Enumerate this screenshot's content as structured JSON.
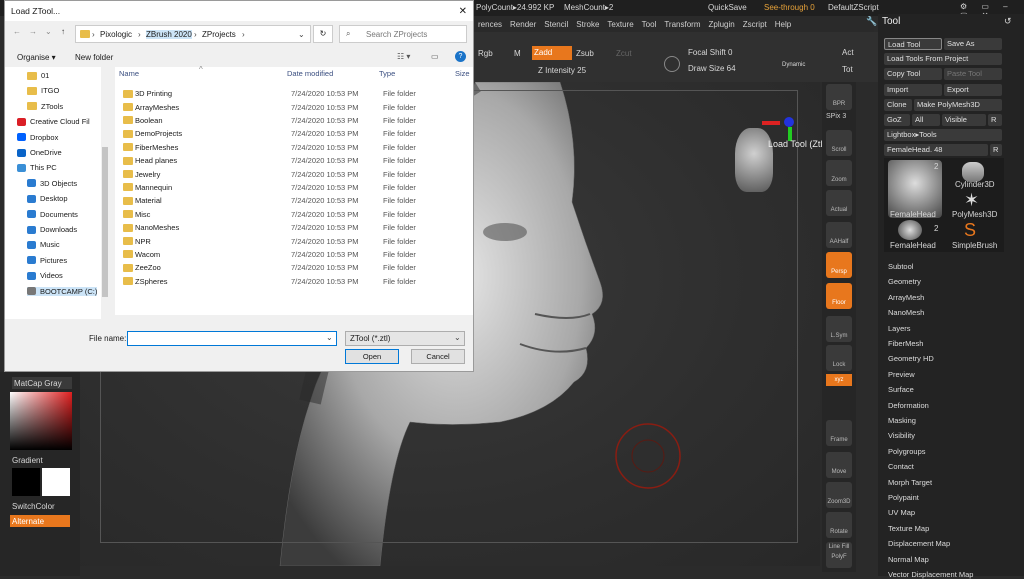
{
  "zbrush": {
    "topbar": {
      "polycount": "PolyCount▸24.992 KP",
      "meshcount": "MeshCount▸2",
      "quicksave": "QuickSave",
      "seethrough": "See-through 0",
      "script": "DefaultZScript"
    },
    "menu": [
      "rences",
      "Render",
      "Stencil",
      "Stroke",
      "Texture",
      "Tool",
      "Transform",
      "Zplugin",
      "Zscript",
      "Help"
    ],
    "shelf": {
      "rgb": "Rgb",
      "m": "M",
      "zadd": "Zadd",
      "zsub": "Zsub",
      "zcut": "Zcut",
      "zintensity": "Z Intensity 25",
      "focal": "Focal Shift 0",
      "drawsize": "Draw Size 64",
      "dynamic": "Dynamic",
      "act": "Act",
      "tot": "Tot"
    },
    "canvas_label": "Load Tool (Ztl File)",
    "vbar": [
      "BPR",
      "SPix 3",
      "Scroll",
      "Zoom",
      "Actual",
      "AAHalf",
      "Persp",
      "Floor",
      "L.Sym",
      "Lock",
      "xyz",
      "Frame",
      "Move",
      "Zoom3D",
      "Rotate",
      "Line Fill PolyF"
    ],
    "tool": {
      "title": "Tool",
      "load_tool": "Load Tool",
      "save_as": "Save As",
      "load_from_project": "Load Tools From Project",
      "copy_tool": "Copy Tool",
      "paste_tool": "Paste Tool",
      "import": "Import",
      "export": "Export",
      "clone": "Clone",
      "make_polymesh": "Make PolyMesh3D",
      "goz": "GoZ",
      "all": "All",
      "visible": "Visible",
      "r": "R",
      "lightbox": "Lightbox▸Tools",
      "current": "FemaleHead. 48",
      "thumbs": [
        "FemaleHead",
        "Cylinder3D",
        "FemaleHead",
        "PolyMesh3D",
        "FemaleHead",
        "SimpleBrush"
      ],
      "thumb_count": "2",
      "subpalettes": [
        "Subtool",
        "Geometry",
        "ArrayMesh",
        "NanoMesh",
        "Layers",
        "FiberMesh",
        "Geometry HD",
        "Preview",
        "Surface",
        "Deformation",
        "Masking",
        "Visibility",
        "Polygroups",
        "Contact",
        "Morph Target",
        "Polypaint",
        "UV Map",
        "Texture Map",
        "Displacement Map",
        "Normal Map",
        "Vector Displacement Map"
      ]
    },
    "left": {
      "matcap": "MatCap Gray",
      "gradient": "Gradient",
      "switchcolor": "SwitchColor",
      "alternate": "Alternate"
    }
  },
  "dialog": {
    "title": "Load ZTool...",
    "breadcrumb": [
      "Pixologic",
      "ZBrush 2020",
      "ZProjects"
    ],
    "search_placeholder": "Search ZProjects",
    "organise": "Organise ▾",
    "new_folder": "New folder",
    "help": "?",
    "nav": [
      "01",
      "ITGO",
      "ZTools",
      "Creative Cloud Fil",
      "Dropbox",
      "OneDrive",
      "This PC",
      "3D Objects",
      "Desktop",
      "Documents",
      "Downloads",
      "Music",
      "Pictures",
      "Videos",
      "BOOTCAMP (C:)"
    ],
    "columns": {
      "name": "Name",
      "date": "Date modified",
      "type": "Type",
      "size": "Size"
    },
    "files": [
      {
        "name": "3D Printing",
        "date": "7/24/2020 10:53 PM",
        "type": "File folder"
      },
      {
        "name": "ArrayMeshes",
        "date": "7/24/2020 10:53 PM",
        "type": "File folder"
      },
      {
        "name": "Boolean",
        "date": "7/24/2020 10:53 PM",
        "type": "File folder"
      },
      {
        "name": "DemoProjects",
        "date": "7/24/2020 10:53 PM",
        "type": "File folder"
      },
      {
        "name": "FiberMeshes",
        "date": "7/24/2020 10:53 PM",
        "type": "File folder"
      },
      {
        "name": "Head planes",
        "date": "7/24/2020 10:53 PM",
        "type": "File folder"
      },
      {
        "name": "Jewelry",
        "date": "7/24/2020 10:53 PM",
        "type": "File folder"
      },
      {
        "name": "Mannequin",
        "date": "7/24/2020 10:53 PM",
        "type": "File folder"
      },
      {
        "name": "Material",
        "date": "7/24/2020 10:53 PM",
        "type": "File folder"
      },
      {
        "name": "Misc",
        "date": "7/24/2020 10:53 PM",
        "type": "File folder"
      },
      {
        "name": "NanoMeshes",
        "date": "7/24/2020 10:53 PM",
        "type": "File folder"
      },
      {
        "name": "NPR",
        "date": "7/24/2020 10:53 PM",
        "type": "File folder"
      },
      {
        "name": "Wacom",
        "date": "7/24/2020 10:53 PM",
        "type": "File folder"
      },
      {
        "name": "ZeeZoo",
        "date": "7/24/2020 10:53 PM",
        "type": "File folder"
      },
      {
        "name": "ZSpheres",
        "date": "7/24/2020 10:53 PM",
        "type": "File folder"
      }
    ],
    "filename_label": "File name:",
    "filename_value": "",
    "filetype": "ZTool (*.ztl)",
    "open": "Open",
    "cancel": "Cancel"
  }
}
